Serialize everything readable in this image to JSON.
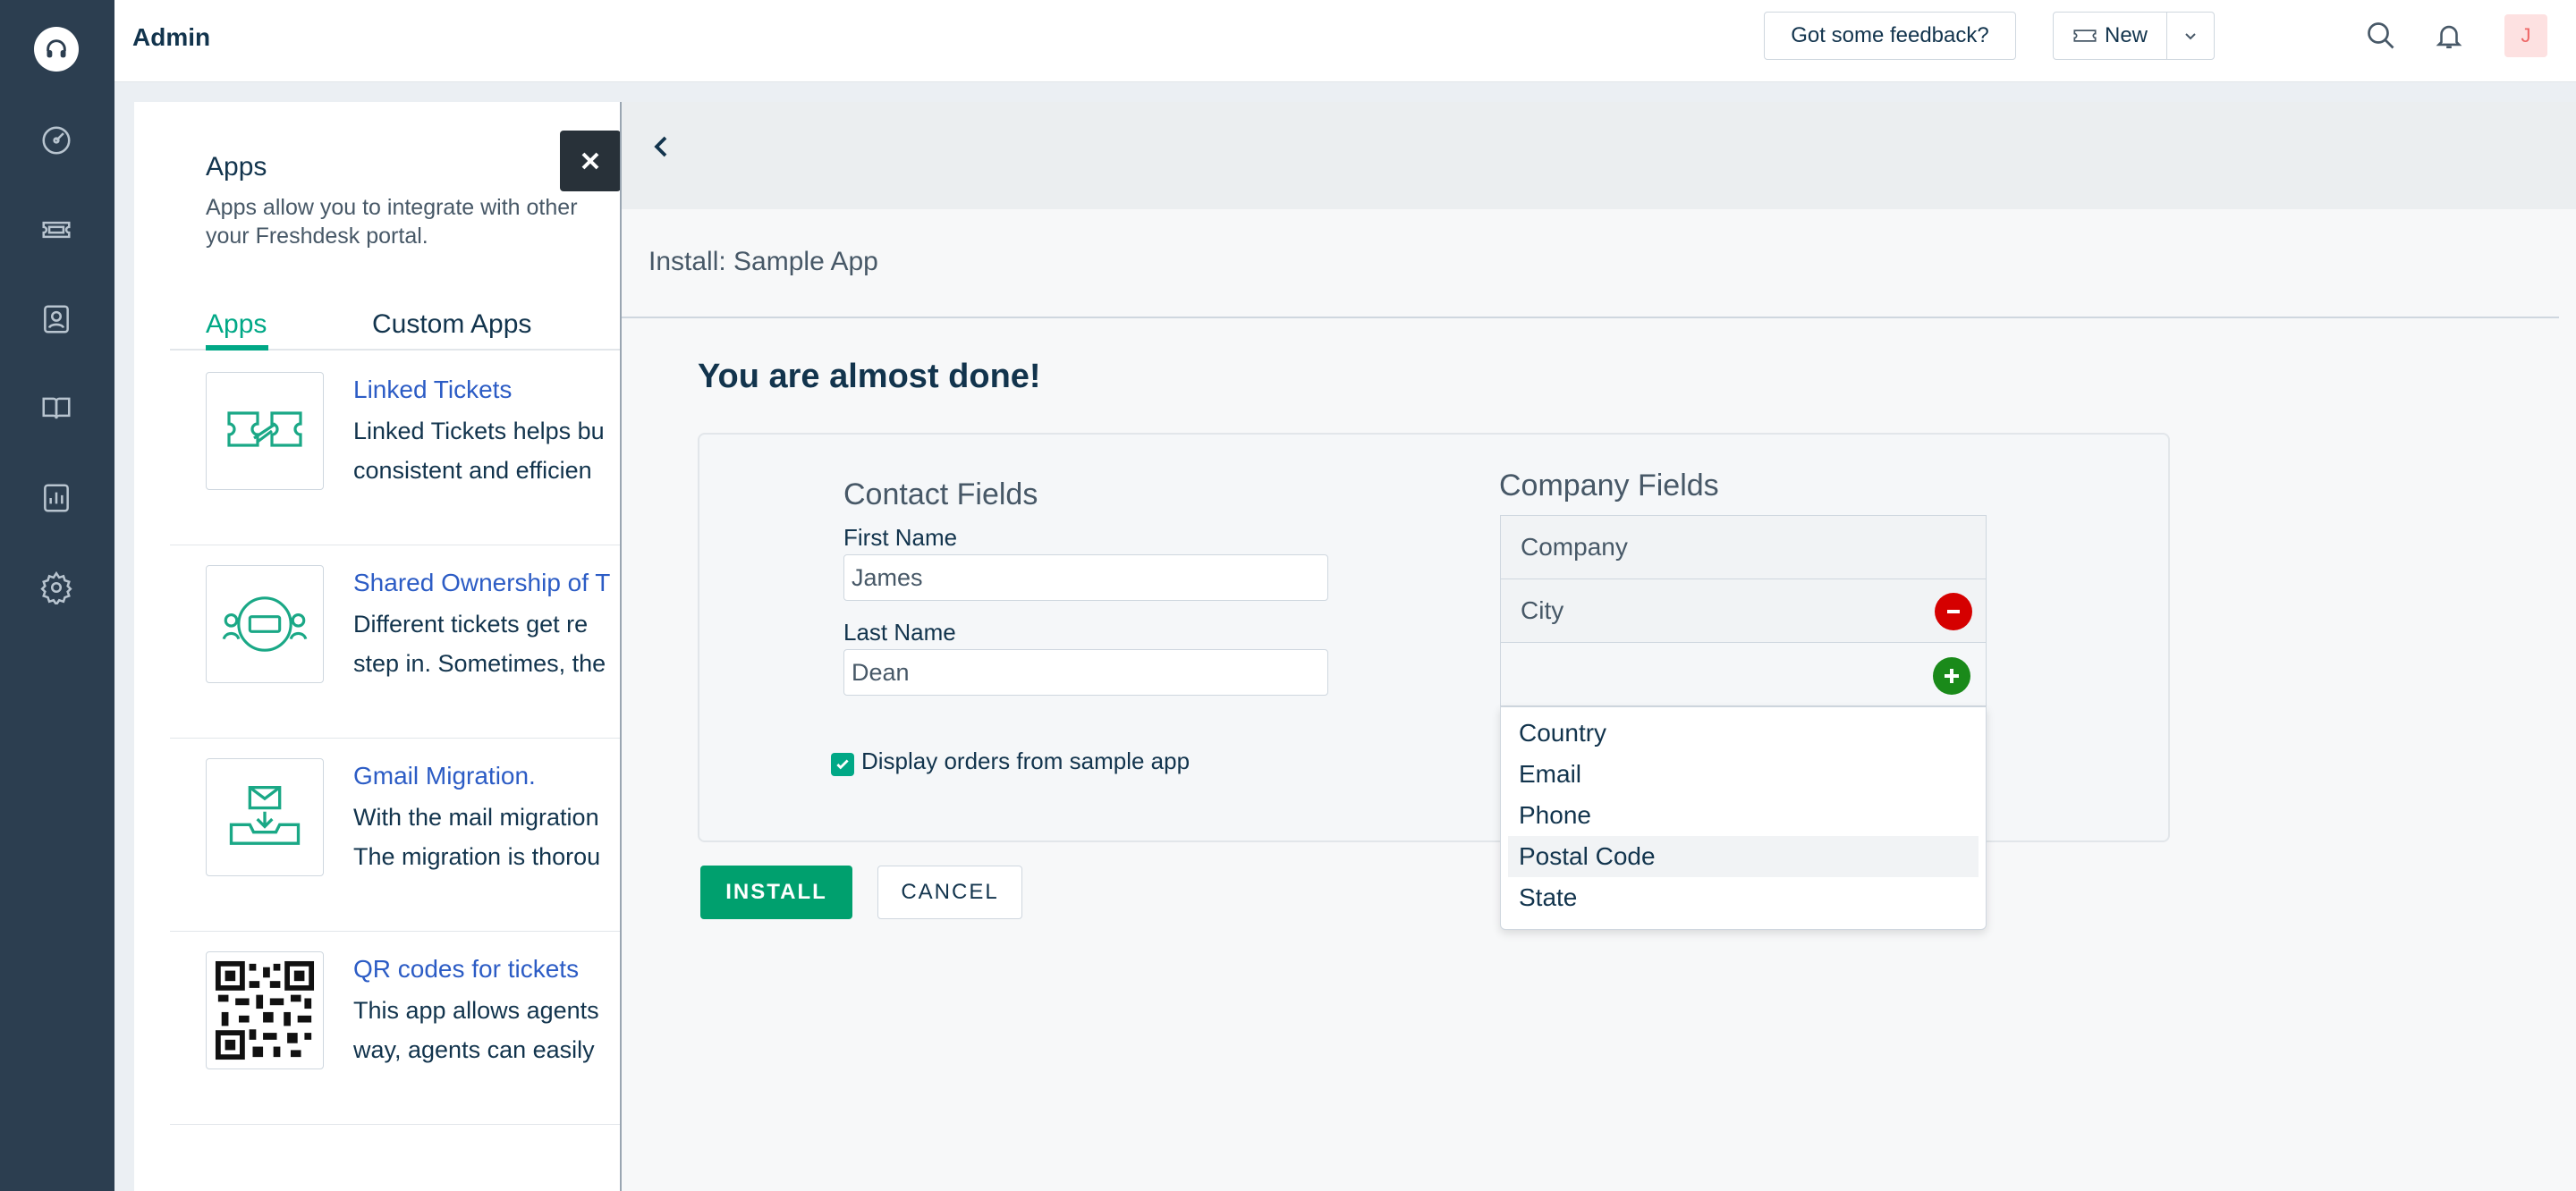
{
  "topbar": {
    "title": "Admin",
    "feedback_label": "Got some feedback?",
    "new_label": "New",
    "avatar_initial": "J"
  },
  "sidebar": {
    "icons": [
      "logo-headset-icon",
      "dashboard-icon",
      "tickets-icon",
      "contacts-icon",
      "knowledge-base-icon",
      "reports-icon",
      "settings-icon"
    ]
  },
  "apps_page": {
    "heading": "Apps",
    "description_line1": "Apps allow you to integrate with other",
    "description_line2": "your Freshdesk portal.",
    "tabs": [
      {
        "label": "Apps",
        "active": true
      },
      {
        "label": "Custom Apps",
        "active": false
      }
    ],
    "items": [
      {
        "name": "Linked Tickets",
        "line1": "Linked Tickets helps bu",
        "line2": "consistent and efficien"
      },
      {
        "name": "Shared Ownership of T",
        "line1": "Different tickets get re",
        "line2": "step in. Sometimes, the"
      },
      {
        "name": "Gmail Migration.",
        "line1": "With the mail migration",
        "line2": "The migration is thorou"
      },
      {
        "name": "QR codes for tickets",
        "line1": "This app allows agents",
        "line2": "way, agents can easily"
      }
    ]
  },
  "modal": {
    "title": "Install: Sample App",
    "heading": "You are almost done!",
    "contact": {
      "title": "Contact Fields",
      "first_name_label": "First Name",
      "first_name_value": "James",
      "last_name_label": "Last Name",
      "last_name_value": "Dean"
    },
    "checkbox_label": "Display orders from sample app",
    "checkbox_checked": true,
    "company": {
      "title": "Company Fields",
      "fields": [
        "Company",
        "City"
      ],
      "dropdown_options": [
        "Country",
        "Email",
        "Phone",
        "Postal Code",
        "State"
      ],
      "highlighted_option": "Postal Code"
    },
    "install_label": "INSTALL",
    "cancel_label": "CANCEL"
  },
  "colors": {
    "sidebar": "#2c3e50",
    "accent_green": "#00a886",
    "install_green": "#00a06e",
    "link_blue": "#2c5cc5",
    "remove_red": "#d50000",
    "add_green": "#1a8a1a"
  }
}
